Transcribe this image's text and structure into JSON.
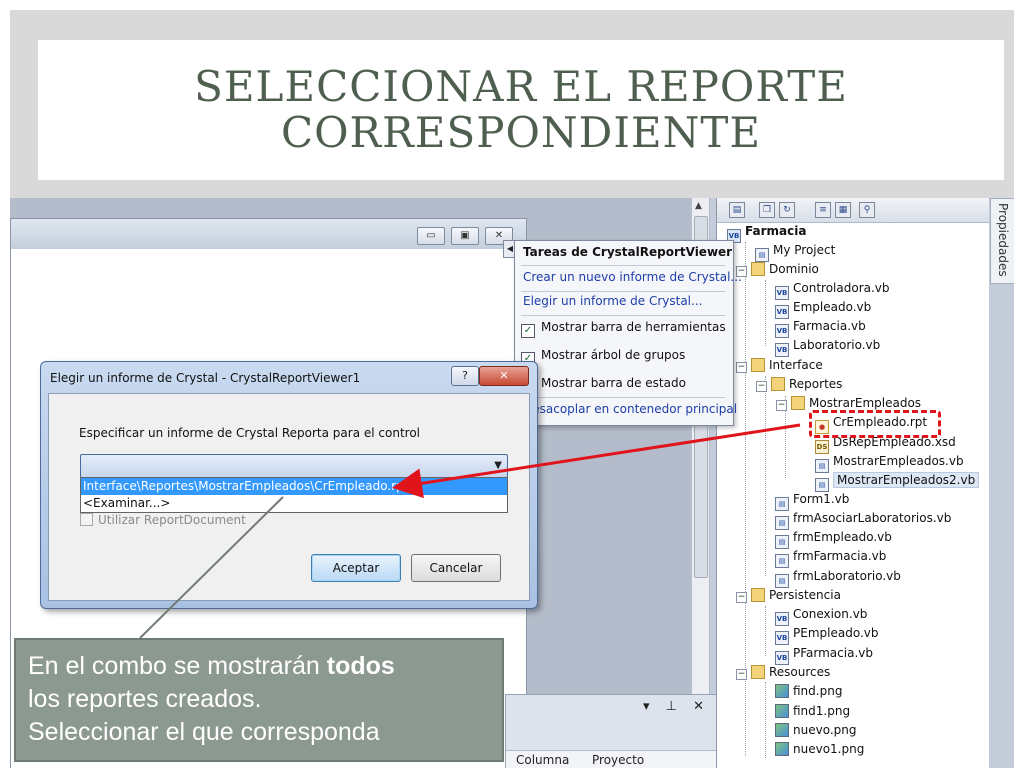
{
  "slide": {
    "title_line1": "SELECCIONAR EL REPORTE",
    "title_line2": "CORRESPONDIENTE"
  },
  "designer": {
    "window_buttons": [
      "▭",
      "▣",
      "✕"
    ]
  },
  "tasks_panel": {
    "title": "Tareas de CrystalReportViewer",
    "links": [
      "Crear un nuevo informe de Crystal...",
      "Elegir un informe de Crystal..."
    ],
    "checks": [
      {
        "label": "Mostrar barra de herramientas",
        "checked": true
      },
      {
        "label": "Mostrar árbol de grupos",
        "checked": true
      },
      {
        "label": "Mostrar barra de estado",
        "checked": true
      }
    ],
    "undock_link": "Desacoplar en contenedor principal"
  },
  "dialog": {
    "title": "Elegir un informe de Crystal - CrystalReportViewer1",
    "help_button": "?",
    "close_button": "✕",
    "label": "Especificar un informe de Crystal Reporta para el control",
    "combo_value": "",
    "dropdown_options": [
      "Interface\\Reportes\\MostrarEmpleados\\CrEmpleado.rpt",
      "<Examinar...>"
    ],
    "use_report_document": "Utilizar ReportDocument",
    "ok_button": "Aceptar",
    "cancel_button": "Cancelar"
  },
  "bottom_panel": {
    "tool_glyphs": "▾ ⊥ ✕",
    "columns": [
      "Columna",
      "Proyecto"
    ]
  },
  "properties_tab": "Propiedades",
  "solution_explorer": {
    "items": [
      {
        "label": "Farmacia",
        "icon": "vb-project-icon",
        "bold": true
      },
      {
        "label": "My Project",
        "icon": "my-project-icon"
      },
      {
        "label": "Dominio",
        "icon": "folder-icon"
      },
      {
        "label": "Controladora.vb",
        "icon": "vb-file-icon"
      },
      {
        "label": "Empleado.vb",
        "icon": "vb-file-icon"
      },
      {
        "label": "Farmacia.vb",
        "icon": "vb-file-icon"
      },
      {
        "label": "Laboratorio.vb",
        "icon": "vb-file-icon"
      },
      {
        "label": "Interface",
        "icon": "folder-icon"
      },
      {
        "label": "Reportes",
        "icon": "folder-icon"
      },
      {
        "label": "MostrarEmpleados",
        "icon": "folder-icon"
      },
      {
        "label": "CrEmpleado.rpt",
        "icon": "crystal-report-icon"
      },
      {
        "label": "DsRepEmpleado.xsd",
        "icon": "dataset-icon"
      },
      {
        "label": "MostrarEmpleados.vb",
        "icon": "form-icon"
      },
      {
        "label": "MostrarEmpleados2.vb",
        "icon": "form-icon",
        "selected": true
      },
      {
        "label": "Form1.vb",
        "icon": "form-icon"
      },
      {
        "label": "frmAsociarLaboratorios.vb",
        "icon": "form-icon"
      },
      {
        "label": "frmEmpleado.vb",
        "icon": "form-icon"
      },
      {
        "label": "frmFarmacia.vb",
        "icon": "form-icon"
      },
      {
        "label": "frmLaboratorio.vb",
        "icon": "form-icon"
      },
      {
        "label": "Persistencia",
        "icon": "folder-icon"
      },
      {
        "label": "Conexion.vb",
        "icon": "vb-file-icon"
      },
      {
        "label": "PEmpleado.vb",
        "icon": "vb-file-icon"
      },
      {
        "label": "PFarmacia.vb",
        "icon": "vb-file-icon"
      },
      {
        "label": "Resources",
        "icon": "folder-icon"
      },
      {
        "label": "find.png",
        "icon": "image-icon"
      },
      {
        "label": "find1.png",
        "icon": "image-icon"
      },
      {
        "label": "nuevo.png",
        "icon": "image-icon"
      },
      {
        "label": "nuevo1.png",
        "icon": "image-icon"
      }
    ]
  },
  "callout": {
    "text_before": "En el combo se mostrarán ",
    "text_bold": "todos",
    "text_after_line": "los reportes creados.",
    "text_line3": "Seleccionar el que corresponda"
  },
  "colors": {
    "arrow": "#e0141a",
    "callout_bg": "#8c9990",
    "title_text": "#4f5f4f",
    "selection": "#3399ff"
  }
}
